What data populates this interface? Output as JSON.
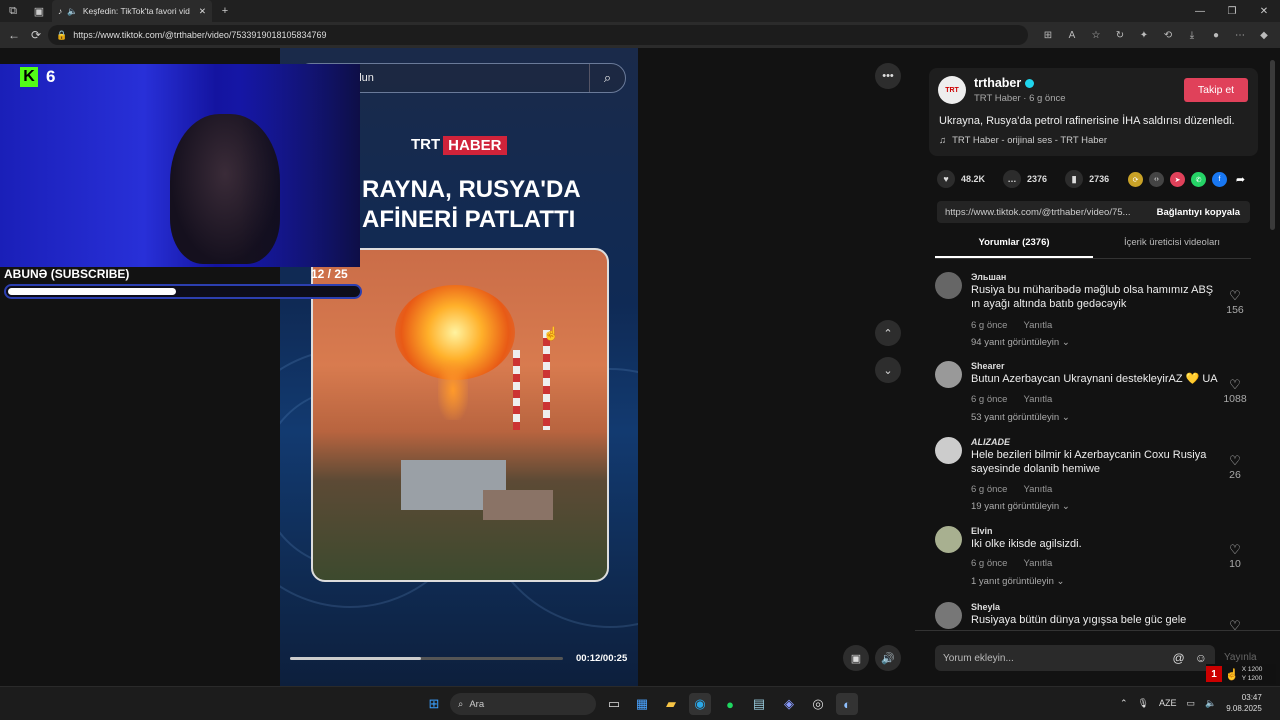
{
  "browser": {
    "tab_title": "Keşfedin: TikTok'ta favori vid",
    "url": "https://www.tiktok.com/@trthaber/video/7533919018105834769"
  },
  "overlay": {
    "kick_count": "6",
    "title": "ABUNƏ (SUBSCRIBE)",
    "count": "12  / 25",
    "progress": 0.48
  },
  "player": {
    "search_text": "bulun",
    "brand_a": "TRT",
    "brand_b": "HABER",
    "headline1": "RAYNA, RUSYA'DA",
    "headline2": "AFİNERİ PATLATTI",
    "time": "00:12/00:25",
    "progress": 0.48
  },
  "post": {
    "author": "trthaber",
    "meta": "TRT Haber · 6 g önce",
    "follow": "Takip et",
    "caption": "Ukrayna, Rusya'da petrol rafinerisine İHA saldırısı düzenledi.",
    "sound": "TRT Haber - orijinal ses - TRT Haber",
    "likes": "48.2K",
    "comments": "2376",
    "saves": "2736",
    "link": "https://www.tiktok.com/@trthaber/video/75...",
    "copy": "Bağlantıyı kopyala",
    "tab_comments": "Yorumlar (2376)",
    "tab_creator": "İçerik üreticisi videoları"
  },
  "comments": [
    {
      "user": "Эльшан",
      "text": "Rusiya bu müharibədə məğlub olsa hamımız ABŞ ın ayağı altında batıb gedəcəyik",
      "time": "6 g önce",
      "reply": "Yanıtla",
      "replies": "94 yanıt görüntüleyin",
      "likes": "156"
    },
    {
      "user": "Shearer",
      "text": "Butun Azerbaycan Ukraynani destekleyirAZ 💛 UA",
      "time": "6 g önce",
      "reply": "Yanıtla",
      "replies": "53 yanıt görüntüleyin",
      "likes": "1088"
    },
    {
      "user": "ALIZADE",
      "text": "Hele bezileri bilmir ki Azerbaycanin Coxu Rusiya sayesinde dolanib hemiwe",
      "time": "6 g önce",
      "reply": "Yanıtla",
      "replies": "19 yanıt görüntüleyin",
      "likes": "26"
    },
    {
      "user": "Elvin",
      "text": "Iki olke ikisde agilsizdi.",
      "time": "6 g önce",
      "reply": "Yanıtla",
      "replies": "1 yanıt görüntüleyin",
      "likes": "10"
    },
    {
      "user": "Sheyla",
      "text": "Rusiyaya bütün dünya yıgışsa bele güc gele",
      "time": "",
      "reply": "",
      "replies": "",
      "likes": ""
    }
  ],
  "input": {
    "placeholder": "Yorum ekleyin...",
    "post": "Yayınla"
  },
  "coords": {
    "x": "X 1200",
    "y": "Y 1200"
  },
  "taskbar": {
    "search": "Ara",
    "lang": "AZE",
    "time": "03:47",
    "date": "9.08.2025"
  }
}
